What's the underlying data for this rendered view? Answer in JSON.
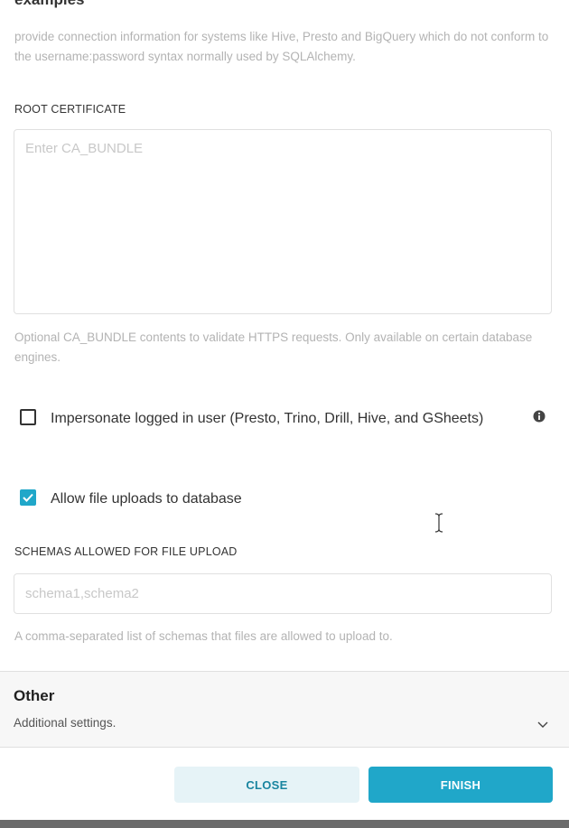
{
  "header": {
    "title": "examples",
    "help_text": "provide connection information for systems like Hive, Presto and BigQuery which do not conform to the username:password syntax normally used by SQLAlchemy."
  },
  "root_certificate": {
    "label": "ROOT CERTIFICATE",
    "placeholder": "Enter CA_BUNDLE",
    "value": "",
    "help_text": "Optional CA_BUNDLE contents to validate HTTPS requests. Only available on certain database engines."
  },
  "impersonate": {
    "label": "Impersonate logged in user (Presto, Trino, Drill, Hive, and GSheets)",
    "checked": false,
    "info_icon": "info-icon"
  },
  "allow_file_uploads": {
    "label": "Allow file uploads to database",
    "checked": true
  },
  "schemas": {
    "label": "SCHEMAS ALLOWED FOR FILE UPLOAD",
    "placeholder": "schema1,schema2",
    "value": "",
    "help_text": "A comma-separated list of schemas that files are allowed to upload to."
  },
  "other_panel": {
    "title": "Other",
    "subtitle": "Additional settings.",
    "expanded": false
  },
  "footer": {
    "close_label": "CLOSE",
    "finish_label": "FINISH"
  },
  "colors": {
    "primary": "#20a7c9",
    "secondary_bg": "#e6f3f7",
    "secondary_text": "#1985a0",
    "help_text": "#b3b3b3"
  }
}
